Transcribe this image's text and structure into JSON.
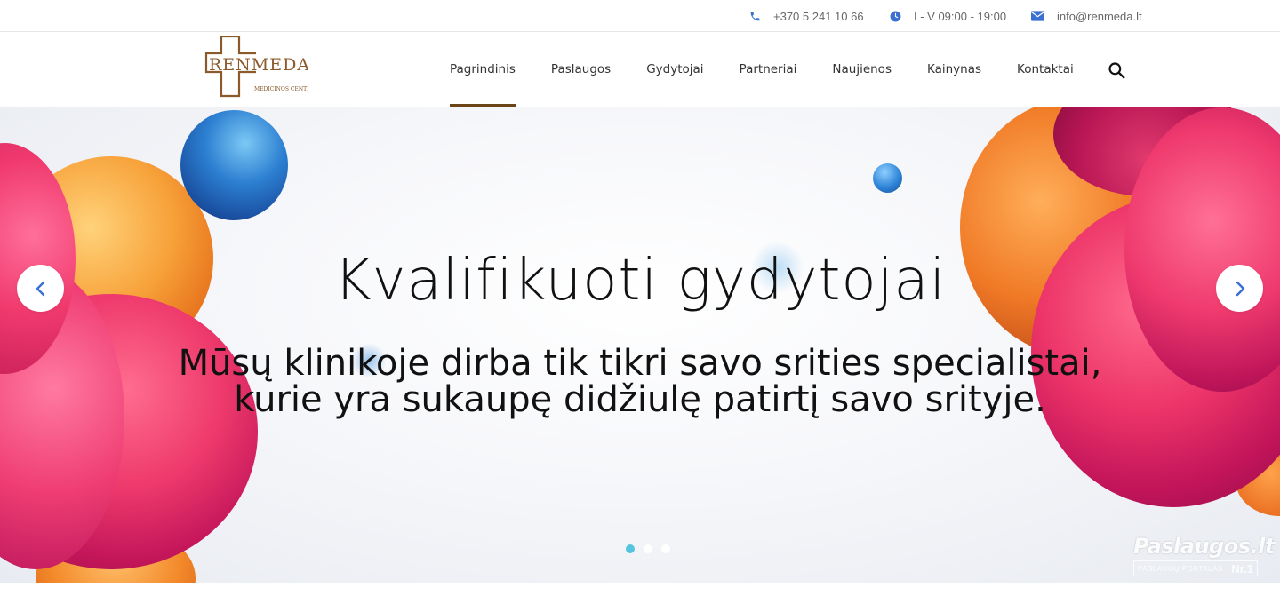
{
  "topbar": {
    "phone": "+370 5 241 10 66",
    "hours": "I - V 09:00 - 19:00",
    "email": "info@renmeda.lt"
  },
  "logo": {
    "name": "RENMEDA",
    "subtitle": "MEDICINOS CENTRAS",
    "color": "#8b5a2b"
  },
  "nav": {
    "items": [
      {
        "label": "Pagrindinis",
        "active": true
      },
      {
        "label": "Paslaugos"
      },
      {
        "label": "Gydytojai"
      },
      {
        "label": "Partneriai"
      },
      {
        "label": "Naujienos"
      },
      {
        "label": "Kainynas"
      },
      {
        "label": "Kontaktai"
      }
    ],
    "search_icon": "search-icon",
    "active_color": "#6b4518"
  },
  "hero": {
    "title": "Kvalifikuoti gydytojai",
    "subtitle_line1": "Mūsų klinikoje dirba tik tikri savo srities specialistai,",
    "subtitle_line2": "kurie yra sukaupę didžiulę patirtį savo srityje.",
    "prev_icon": "chevron-left-icon",
    "next_icon": "chevron-right-icon",
    "slide_count": 3,
    "active_slide": 1,
    "dot_active_color": "#54c5dd"
  },
  "watermark": {
    "title": "Paslaugos.lt",
    "sub": "PASLAUGŲ PORTALAS",
    "badge": "Nr.1"
  }
}
